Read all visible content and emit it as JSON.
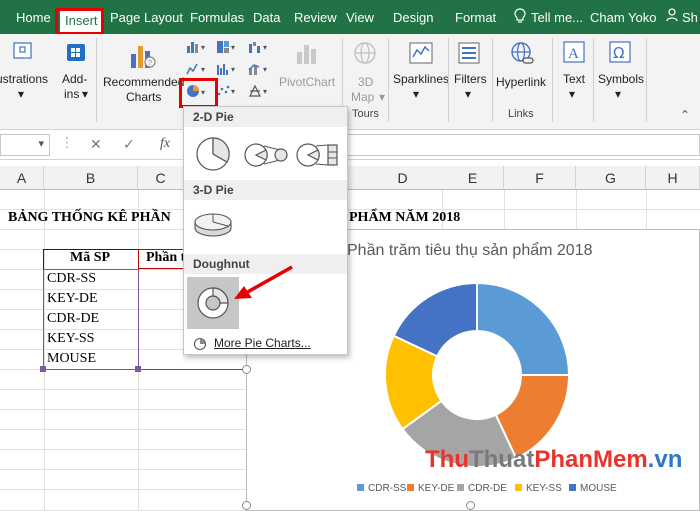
{
  "tabs": [
    {
      "label": "Home"
    },
    {
      "label": "Insert"
    },
    {
      "label": "Page Layout"
    },
    {
      "label": "Formulas"
    },
    {
      "label": "Data"
    },
    {
      "label": "Review"
    },
    {
      "label": "View"
    },
    {
      "label": "Design"
    },
    {
      "label": "Format"
    },
    {
      "label": "Tell me..."
    },
    {
      "label": "Cham Yoko"
    },
    {
      "label": "Sh"
    }
  ],
  "ribbon": {
    "illustrations": "ustrations",
    "addins_line1": "Add-",
    "addins_line2": "ins",
    "recommended_line1": "Recommended",
    "recommended_line2": "Charts",
    "pivotchart": "PivotChart",
    "map3d_line1": "3D",
    "map3d_line2": "Map",
    "tours": "Tours",
    "sparklines": "Sparklines",
    "filters": "Filters",
    "hyperlink": "Hyperlink",
    "links": "Links",
    "text": "Text",
    "symbols": "Symbols"
  },
  "formula_bar": {
    "fx": "fx",
    "cancel": "✕",
    "enter": "✓"
  },
  "columns": [
    "A",
    "B",
    "C",
    "D",
    "E",
    "F",
    "G",
    "H"
  ],
  "sheet": {
    "title_left": "BẢNG THỐNG KÊ PHẦN",
    "title_right": "PHẨM NĂM 2018",
    "header_ma_sp": "Mã SP",
    "header_phan": "Phần t",
    "products": [
      "CDR-SS",
      "KEY-DE",
      "CDR-DE",
      "KEY-SS",
      "MOUSE"
    ]
  },
  "dropdown": {
    "section_2d": "2-D Pie",
    "section_3d": "3-D Pie",
    "section_doughnut": "Doughnut",
    "more_prefix": "M",
    "more_rest": "ore Pie Charts..."
  },
  "chart_data": {
    "type": "doughnut",
    "title": "Phần trăm tiêu thụ sản phẩm 2018",
    "categories": [
      "CDR-SS",
      "KEY-DE",
      "CDR-DE",
      "KEY-SS",
      "MOUSE"
    ],
    "values": [
      25,
      18,
      22,
      17,
      18
    ],
    "colors": [
      "#5b9bd5",
      "#ed7d31",
      "#a5a5a5",
      "#ffc000",
      "#4472c4"
    ],
    "legend_position": "bottom"
  },
  "watermark": {
    "p1": "Thu",
    "p2": "Thuat",
    "p3": "PhanMem",
    "p4": ".vn"
  },
  "colors": {
    "excel_green": "#217346",
    "highlight_red": "#e60000"
  }
}
